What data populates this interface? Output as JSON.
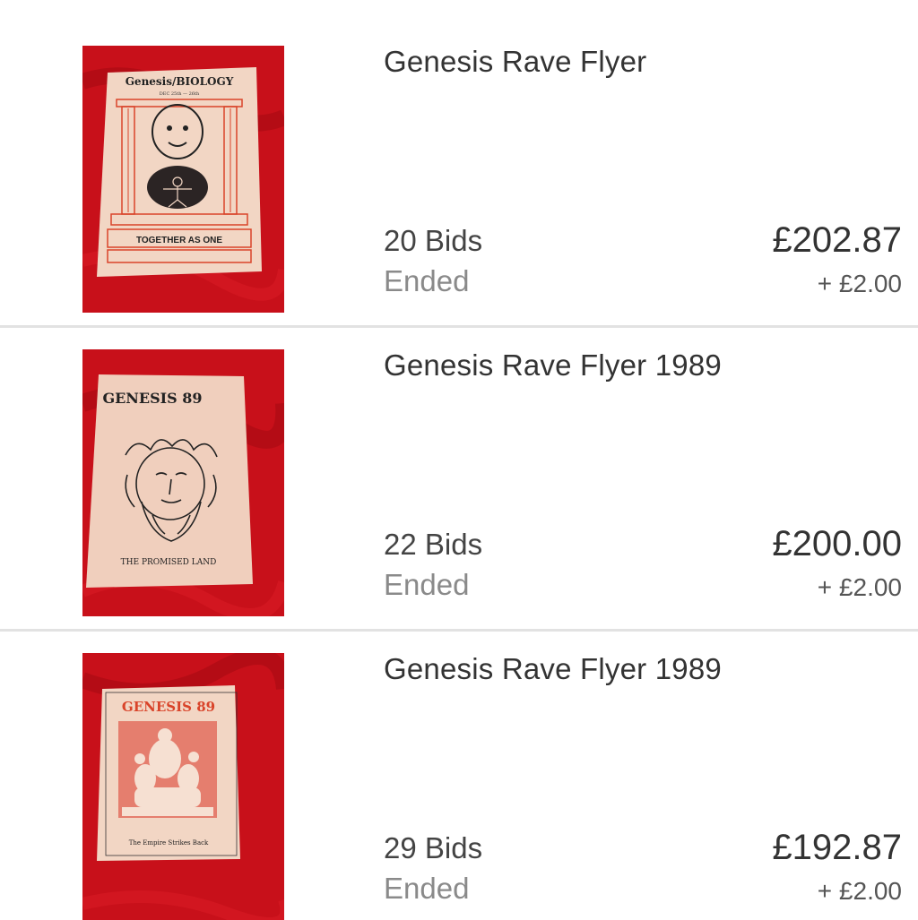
{
  "listings": [
    {
      "title": "Genesis Rave Flyer",
      "bids": "20 Bids",
      "status": "Ended",
      "price": "£202.87",
      "shipping": "+ £2.00",
      "flyer": {
        "header": "Genesis/BIOLOGY",
        "date": "DEC 25th — 26th",
        "footer": "TOGETHER AS ONE"
      }
    },
    {
      "title": "Genesis Rave Flyer 1989",
      "bids": "22 Bids",
      "status": "Ended",
      "price": "£200.00",
      "shipping": "+ £2.00",
      "flyer": {
        "header": "GENESIS 89",
        "footer": "THE PROMISED LAND"
      }
    },
    {
      "title": "Genesis Rave Flyer 1989",
      "bids": "29 Bids",
      "status": "Ended",
      "price": "£192.87",
      "shipping": "+ £2.00",
      "flyer": {
        "header": "GENESIS 89",
        "footer": "The Empire Strikes Back"
      }
    }
  ],
  "colors": {
    "fabric": "#c8101a",
    "paper": "#f2d6c4",
    "ink_red": "#d9442a",
    "divider": "#e2e2e2"
  }
}
